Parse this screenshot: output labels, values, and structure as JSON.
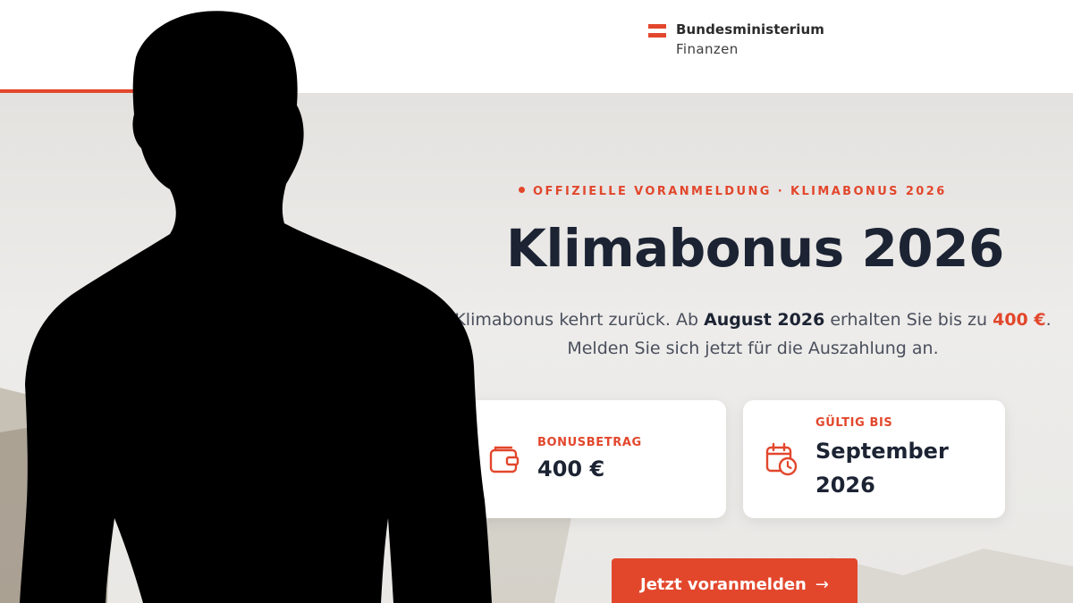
{
  "header": {
    "logo_line1": "Bundesministerium",
    "logo_line2": "Finanzen",
    "accent_color": "#e2472c"
  },
  "hero": {
    "eyebrow": "OFFIZIELLE VORANMELDUNG · KLIMABONUS 2026",
    "title": "Klimabonus 2026",
    "subtitle": {
      "part1": "Klimabonus kehrt zurück. Ab ",
      "strong": "August 2026",
      "part2": " erhalten Sie bis zu ",
      "accent": "400 €",
      "part3": ".",
      "line2": "Melden Sie sich jetzt für die Auszahlung an."
    }
  },
  "cards": {
    "bonus": {
      "label": "BONUSBETRAG",
      "value": "400 €",
      "icon": "wallet-icon"
    },
    "valid": {
      "label": "GÜLTIG BIS",
      "value": "September 2026",
      "icon": "calendar-clock-icon"
    }
  },
  "cta": {
    "label": "Jetzt voranmelden",
    "arrow": "→"
  },
  "overlay": {
    "description_icon": "person-silhouette",
    "color": "#000000"
  }
}
